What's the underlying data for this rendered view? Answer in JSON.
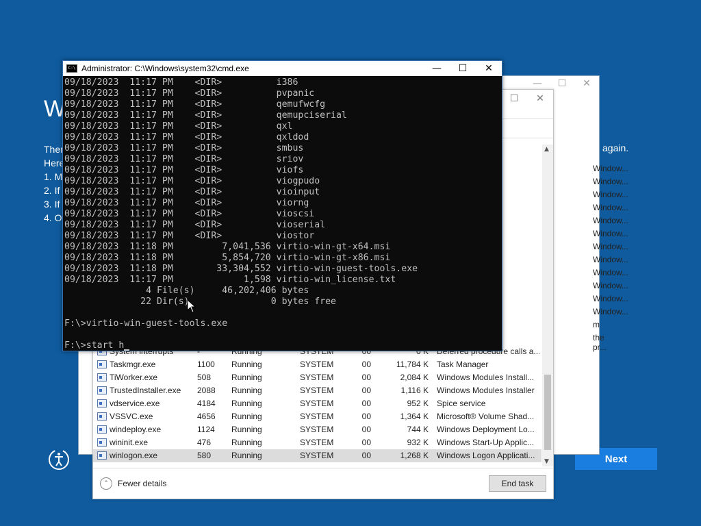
{
  "setup": {
    "title_fragment": "W",
    "lines": [
      "Ther",
      "Here",
      "1. M",
      "2. If",
      "3. If",
      "4. O"
    ],
    "again_text": "again.",
    "next_label": "Next"
  },
  "cmd": {
    "title": "Administrator: C:\\Windows\\system32\\cmd.exe",
    "icon_text": "C:\\",
    "lines": [
      "09/18/2023  11:17 PM    <DIR>          i386",
      "09/18/2023  11:17 PM    <DIR>          pvpanic",
      "09/18/2023  11:17 PM    <DIR>          qemufwcfg",
      "09/18/2023  11:17 PM    <DIR>          qemupciserial",
      "09/18/2023  11:17 PM    <DIR>          qxl",
      "09/18/2023  11:17 PM    <DIR>          qxldod",
      "09/18/2023  11:17 PM    <DIR>          smbus",
      "09/18/2023  11:17 PM    <DIR>          sriov",
      "09/18/2023  11:17 PM    <DIR>          viofs",
      "09/18/2023  11:17 PM    <DIR>          viogpudo",
      "09/18/2023  11:17 PM    <DIR>          vioinput",
      "09/18/2023  11:17 PM    <DIR>          viorng",
      "09/18/2023  11:17 PM    <DIR>          vioscsi",
      "09/18/2023  11:17 PM    <DIR>          vioserial",
      "09/18/2023  11:17 PM    <DIR>          viostor",
      "09/18/2023  11:18 PM         7,041,536 virtio-win-gt-x64.msi",
      "09/18/2023  11:18 PM         5,854,720 virtio-win-gt-x86.msi",
      "09/18/2023  11:18 PM        33,304,552 virtio-win-guest-tools.exe",
      "09/18/2023  11:17 PM             1,598 virtio-win_license.txt",
      "               4 File(s)     46,202,406 bytes",
      "              22 Dir(s)               0 bytes free",
      "",
      "F:\\>virtio-win-guest-tools.exe",
      "",
      "F:\\>start h"
    ]
  },
  "taskmgr": {
    "right_desc": [
      "Window...",
      "Window...",
      "Window...",
      "Window...",
      "Window...",
      "Window...",
      "Window...",
      "Window...",
      "Window...",
      "Window...",
      "Window...",
      "Window...",
      "m",
      "the pr...",
      "Deferred procedure calls a..."
    ],
    "rows": [
      {
        "name": "System interrupts",
        "pid": "-",
        "status": "Running",
        "user": "SYSTEM",
        "cpu": "00",
        "mem": "0 K",
        "desc": "Deferred procedure calls a..."
      },
      {
        "name": "Taskmgr.exe",
        "pid": "1100",
        "status": "Running",
        "user": "SYSTEM",
        "cpu": "00",
        "mem": "11,784 K",
        "desc": "Task Manager"
      },
      {
        "name": "TiWorker.exe",
        "pid": "508",
        "status": "Running",
        "user": "SYSTEM",
        "cpu": "00",
        "mem": "2,084 K",
        "desc": "Windows Modules Install..."
      },
      {
        "name": "TrustedInstaller.exe",
        "pid": "2088",
        "status": "Running",
        "user": "SYSTEM",
        "cpu": "00",
        "mem": "1,116 K",
        "desc": "Windows Modules Installer"
      },
      {
        "name": "vdservice.exe",
        "pid": "4184",
        "status": "Running",
        "user": "SYSTEM",
        "cpu": "00",
        "mem": "952 K",
        "desc": "Spice service"
      },
      {
        "name": "VSSVC.exe",
        "pid": "4656",
        "status": "Running",
        "user": "SYSTEM",
        "cpu": "00",
        "mem": "1,364 K",
        "desc": "Microsoft® Volume Shad..."
      },
      {
        "name": "windeploy.exe",
        "pid": "1124",
        "status": "Running",
        "user": "SYSTEM",
        "cpu": "00",
        "mem": "744 K",
        "desc": "Windows Deployment Lo..."
      },
      {
        "name": "wininit.exe",
        "pid": "476",
        "status": "Running",
        "user": "SYSTEM",
        "cpu": "00",
        "mem": "932 K",
        "desc": "Windows Start-Up Applic..."
      },
      {
        "name": "winlogon.exe",
        "pid": "580",
        "status": "Running",
        "user": "SYSTEM",
        "cpu": "00",
        "mem": "1,268 K",
        "desc": "Windows Logon Applicati..."
      }
    ],
    "selected_index": 8,
    "fewer_details": "Fewer details",
    "end_task": "End task"
  },
  "controls": {
    "minimize": "—",
    "maximize": "☐",
    "close": "✕"
  },
  "icons": {
    "accessibility": "accessibility-icon",
    "collapse": "chevron-up-icon"
  }
}
